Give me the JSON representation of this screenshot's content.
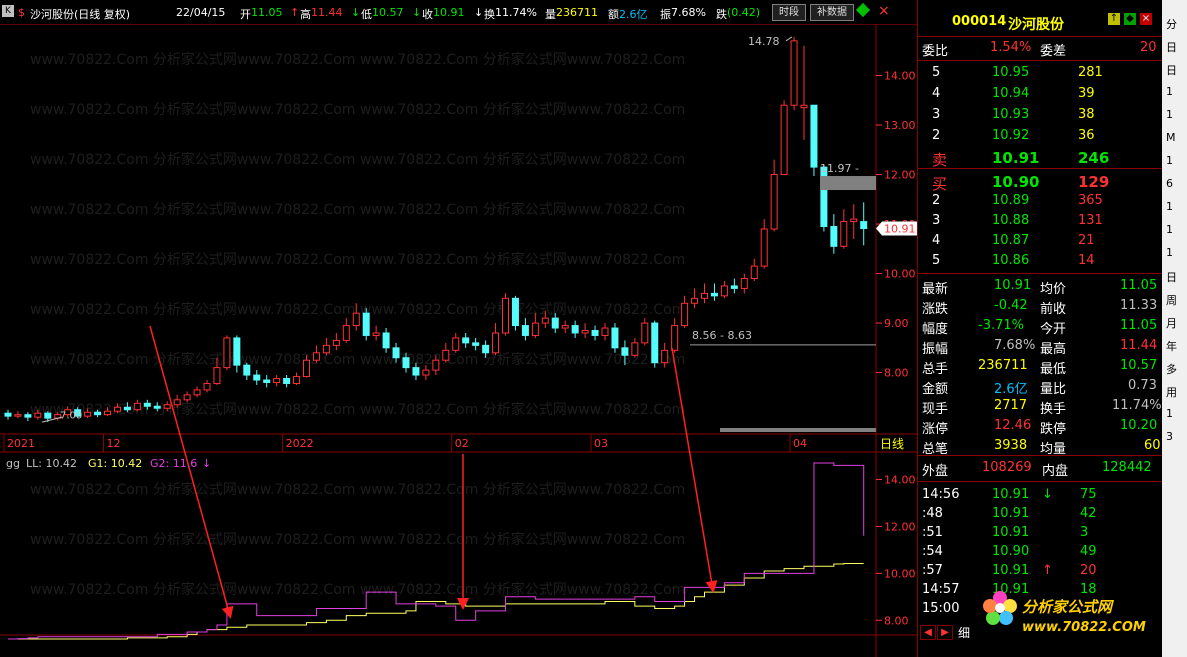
{
  "header": {
    "code_badge": "K",
    "title": "沙河股份(日线 复权)",
    "date": "22/04/15",
    "open_label": "开",
    "open": "11.05",
    "high_label": "高",
    "high": "11.44",
    "low_label": "低",
    "low": "10.57",
    "close_label": "收",
    "close": "10.91",
    "turnover_label": "换",
    "turnover": "11.74%",
    "volume_label": "量",
    "volume": "236711",
    "amount_label": "额",
    "amount": "2.6亿",
    "amplitude_label": "振",
    "amplitude": "7.68%",
    "change_label": "跌",
    "change": "(0.42)",
    "btn_time": "时段",
    "btn_supplement": "补数据"
  },
  "watermark": {
    "text": "www.70822.Com   分析家公式网www.70822.Com"
  },
  "annotations": {
    "peak_label": "14.78",
    "resistance_label": "11.97",
    "support_label": "8.56 - 8.63",
    "early_label": "7.00",
    "current_price_tag": "10.91",
    "axis_tag": "日线"
  },
  "date_axis": [
    {
      "label": "2021",
      "i": 0
    },
    {
      "label": "12",
      "i": 10
    },
    {
      "label": "2022",
      "i": 28
    },
    {
      "label": "02",
      "i": 45
    },
    {
      "label": "03",
      "i": 59
    },
    {
      "label": "04",
      "i": 79
    }
  ],
  "indicator": {
    "name": "gg",
    "ll_label": "LL: 10.42",
    "g1_label": "G1: 10.42",
    "g2_label": "G2: 11.6"
  },
  "chart_data": [
    {
      "type": "candlestick",
      "ylim": [
        6.8,
        15.0
      ],
      "yticks": [
        "8.00",
        "9.00",
        "10.00",
        "11.00",
        "12.00",
        "13.00",
        "14.00"
      ],
      "colors": {
        "up": "#ff3232",
        "down": "#54fcfc"
      },
      "candles": [
        [
          7.18,
          7.12,
          7.25,
          7.05
        ],
        [
          7.12,
          7.15,
          7.22,
          7.08
        ],
        [
          7.15,
          7.1,
          7.2,
          7.02
        ],
        [
          7.1,
          7.18,
          7.25,
          7.05
        ],
        [
          7.18,
          7.08,
          7.22,
          7.0
        ],
        [
          7.08,
          7.15,
          7.2,
          7.03
        ],
        [
          7.15,
          7.25,
          7.32,
          7.1
        ],
        [
          7.25,
          7.12,
          7.3,
          7.08
        ],
        [
          7.12,
          7.2,
          7.28,
          7.08
        ],
        [
          7.2,
          7.15,
          7.25,
          7.1
        ],
        [
          7.15,
          7.22,
          7.3,
          7.12
        ],
        [
          7.22,
          7.3,
          7.38,
          7.18
        ],
        [
          7.3,
          7.25,
          7.4,
          7.2
        ],
        [
          7.25,
          7.38,
          7.45,
          7.22
        ],
        [
          7.38,
          7.32,
          7.45,
          7.25
        ],
        [
          7.32,
          7.28,
          7.4,
          7.22
        ],
        [
          7.28,
          7.35,
          7.42,
          7.22
        ],
        [
          7.35,
          7.45,
          7.55,
          7.3
        ],
        [
          7.45,
          7.55,
          7.62,
          7.4
        ],
        [
          7.55,
          7.65,
          7.72,
          7.5
        ],
        [
          7.65,
          7.78,
          7.85,
          7.6
        ],
        [
          7.78,
          8.1,
          8.3,
          7.75
        ],
        [
          8.1,
          8.7,
          8.75,
          8.05
        ],
        [
          8.7,
          8.15,
          8.75,
          8.0
        ],
        [
          8.15,
          7.95,
          8.2,
          7.85
        ],
        [
          7.95,
          7.85,
          8.05,
          7.75
        ],
        [
          7.85,
          7.8,
          7.95,
          7.7
        ],
        [
          7.8,
          7.88,
          7.95,
          7.72
        ],
        [
          7.88,
          7.78,
          7.95,
          7.7
        ],
        [
          7.78,
          7.92,
          8.0,
          7.75
        ],
        [
          7.92,
          8.25,
          8.35,
          7.9
        ],
        [
          8.25,
          8.4,
          8.55,
          8.2
        ],
        [
          8.4,
          8.55,
          8.7,
          8.35
        ],
        [
          8.55,
          8.65,
          8.8,
          8.45
        ],
        [
          8.65,
          8.95,
          9.1,
          8.6
        ],
        [
          8.95,
          9.2,
          9.4,
          8.85
        ],
        [
          9.2,
          8.75,
          9.3,
          8.65
        ],
        [
          8.75,
          8.8,
          8.95,
          8.65
        ],
        [
          8.8,
          8.5,
          8.9,
          8.4
        ],
        [
          8.5,
          8.3,
          8.6,
          8.2
        ],
        [
          8.3,
          8.1,
          8.4,
          8.0
        ],
        [
          8.1,
          7.95,
          8.2,
          7.85
        ],
        [
          7.95,
          8.05,
          8.15,
          7.85
        ],
        [
          8.05,
          8.25,
          8.35,
          7.95
        ],
        [
          8.25,
          8.45,
          8.6,
          8.2
        ],
        [
          8.45,
          8.7,
          8.8,
          8.4
        ],
        [
          8.7,
          8.6,
          8.8,
          8.5
        ],
        [
          8.6,
          8.55,
          8.7,
          8.45
        ],
        [
          8.55,
          8.4,
          8.65,
          8.3
        ],
        [
          8.4,
          8.8,
          9.0,
          8.35
        ],
        [
          8.8,
          9.5,
          9.6,
          8.75
        ],
        [
          9.5,
          8.95,
          9.55,
          8.85
        ],
        [
          8.95,
          8.75,
          9.1,
          8.65
        ],
        [
          8.75,
          9.0,
          9.2,
          8.7
        ],
        [
          9.0,
          9.1,
          9.25,
          8.9
        ],
        [
          9.1,
          8.9,
          9.2,
          8.8
        ],
        [
          8.9,
          8.95,
          9.05,
          8.8
        ],
        [
          8.95,
          8.8,
          9.05,
          8.7
        ],
        [
          8.8,
          8.85,
          9.0,
          8.7
        ],
        [
          8.85,
          8.75,
          8.95,
          8.65
        ],
        [
          8.75,
          8.9,
          9.0,
          8.65
        ],
        [
          8.9,
          8.5,
          9.0,
          8.4
        ],
        [
          8.5,
          8.35,
          8.65,
          8.15
        ],
        [
          8.35,
          8.6,
          8.7,
          8.3
        ],
        [
          8.6,
          9.0,
          9.1,
          8.55
        ],
        [
          9.0,
          8.2,
          9.05,
          8.1
        ],
        [
          8.2,
          8.45,
          8.6,
          8.1
        ],
        [
          8.45,
          8.95,
          9.1,
          8.4
        ],
        [
          8.95,
          9.4,
          9.55,
          8.9
        ],
        [
          9.4,
          9.5,
          9.7,
          9.3
        ],
        [
          9.5,
          9.6,
          9.8,
          9.4
        ],
        [
          9.6,
          9.55,
          9.8,
          9.45
        ],
        [
          9.55,
          9.75,
          9.85,
          9.5
        ],
        [
          9.75,
          9.7,
          9.9,
          9.6
        ],
        [
          9.7,
          9.9,
          10.0,
          9.6
        ],
        [
          9.9,
          10.15,
          10.3,
          9.85
        ],
        [
          10.15,
          10.9,
          11.1,
          10.1
        ],
        [
          10.9,
          12.0,
          12.3,
          10.85
        ],
        [
          12.0,
          13.4,
          13.5,
          12.4
        ],
        [
          13.4,
          14.7,
          14.78,
          13.3
        ],
        [
          13.35,
          13.4,
          14.6,
          12.7
        ],
        [
          13.4,
          12.15,
          13.3,
          11.97
        ],
        [
          12.15,
          10.95,
          12.2,
          10.85
        ],
        [
          10.95,
          10.55,
          11.2,
          10.4
        ],
        [
          10.55,
          11.05,
          11.3,
          10.5
        ],
        [
          11.05,
          11.1,
          11.4,
          10.7
        ],
        [
          11.05,
          10.91,
          11.44,
          10.57
        ]
      ]
    },
    {
      "type": "line",
      "ylim": [
        7.5,
        15.0
      ],
      "yticks": [
        "8.00",
        "10.00",
        "12.00",
        "14.00"
      ],
      "series": [
        {
          "name": "LL",
          "color": "#ffff60",
          "values": [
            7.2,
            7.2,
            7.2,
            7.2,
            7.2,
            7.2,
            7.2,
            7.2,
            7.2,
            7.2,
            7.2,
            7.2,
            7.25,
            7.25,
            7.25,
            7.25,
            7.3,
            7.3,
            7.4,
            7.5,
            7.6,
            7.6,
            7.7,
            7.7,
            7.8,
            7.8,
            7.8,
            7.8,
            7.8,
            7.8,
            7.9,
            7.9,
            8.0,
            8.0,
            8.2,
            8.2,
            8.3,
            8.3,
            8.3,
            8.3,
            8.4,
            8.8,
            8.8,
            8.8,
            8.7,
            8.7,
            8.6,
            8.6,
            8.6,
            8.6,
            8.7,
            8.7,
            8.7,
            8.7,
            8.7,
            8.7,
            8.7,
            8.7,
            8.7,
            8.7,
            8.8,
            8.8,
            8.8,
            8.6,
            8.6,
            8.5,
            8.5,
            8.6,
            8.8,
            9.0,
            9.2,
            9.2,
            9.5,
            9.5,
            9.8,
            9.8,
            10.1,
            10.1,
            10.2,
            10.2,
            10.3,
            10.3,
            10.3,
            10.4,
            10.42,
            10.42,
            10.42
          ]
        },
        {
          "name": "G1",
          "color": "#e040e0",
          "values": [
            7.2,
            7.22,
            7.25,
            7.3,
            7.3,
            7.3,
            7.3,
            7.3,
            7.3,
            7.3,
            7.3,
            7.3,
            7.3,
            7.3,
            7.3,
            7.4,
            7.4,
            7.4,
            7.5,
            7.5,
            7.6,
            7.8,
            8.7,
            8.7,
            8.7,
            8.2,
            8.2,
            8.2,
            8.2,
            8.2,
            8.2,
            8.5,
            8.5,
            8.5,
            8.5,
            8.5,
            9.2,
            9.2,
            9.2,
            8.7,
            8.7,
            8.7,
            8.7,
            8.6,
            8.6,
            8.0,
            8.0,
            8.4,
            8.4,
            8.4,
            9.0,
            9.0,
            9.0,
            8.9,
            8.9,
            8.9,
            8.9,
            8.9,
            8.9,
            8.9,
            8.9,
            8.9,
            8.9,
            9.0,
            9.0,
            8.8,
            8.8,
            8.8,
            9.4,
            9.4,
            9.4,
            9.4,
            9.6,
            9.6,
            10.0,
            10.0,
            10.0,
            10.0,
            10.0,
            10.0,
            10.0,
            14.7,
            14.7,
            14.6,
            14.6,
            14.6,
            11.6
          ]
        }
      ]
    }
  ],
  "panel": {
    "code": "000014",
    "name": "沙河股份",
    "weibi_label": "委比",
    "weibi": "1.54%",
    "weicha_label": "委差",
    "weicha": "20",
    "asks": [
      {
        "level": "5",
        "price": "10.95",
        "vol": "281"
      },
      {
        "level": "4",
        "price": "10.94",
        "vol": "39"
      },
      {
        "level": "3",
        "price": "10.93",
        "vol": "38"
      },
      {
        "level": "2",
        "price": "10.92",
        "vol": "36"
      },
      {
        "level": "卖",
        "price": "10.91",
        "vol": "246"
      }
    ],
    "bids": [
      {
        "level": "买",
        "price": "10.90",
        "vol": "129"
      },
      {
        "level": "2",
        "price": "10.89",
        "vol": "365"
      },
      {
        "level": "3",
        "price": "10.88",
        "vol": "131"
      },
      {
        "level": "4",
        "price": "10.87",
        "vol": "21"
      },
      {
        "level": "5",
        "price": "10.86",
        "vol": "14"
      }
    ],
    "stats": [
      {
        "l1": "最新",
        "v1": "10.91",
        "c1": "green",
        "l2": "均价",
        "v2": "11.05",
        "c2": "green"
      },
      {
        "l1": "涨跌",
        "v1": "-0.42",
        "c1": "green",
        "l2": "前收",
        "v2": "11.33",
        "c2": "gray"
      },
      {
        "l1": "幅度",
        "v1": "-3.71%",
        "c1": "green",
        "l2": "今开",
        "v2": "11.05",
        "c2": "green"
      },
      {
        "l1": "振幅",
        "v1": "7.68%",
        "c1": "gray",
        "l2": "最高",
        "v2": "11.44",
        "c2": "red"
      },
      {
        "l1": "总手",
        "v1": "236711",
        "c1": "yellow",
        "l2": "最低",
        "v2": "10.57",
        "c2": "green"
      },
      {
        "l1": "金额",
        "v1": "2.6亿",
        "c1": "cyan",
        "l2": "量比",
        "v2": "0.73",
        "c2": "gray"
      },
      {
        "l1": "现手",
        "v1": "2717",
        "c1": "yellow",
        "l2": "换手",
        "v2": "11.74%",
        "c2": "gray"
      },
      {
        "l1": "涨停",
        "v1": "12.46",
        "c1": "red",
        "l2": "跌停",
        "v2": "10.20",
        "c2": "green"
      },
      {
        "l1": "总笔",
        "v1": "3938",
        "c1": "yellow",
        "l2": "均量",
        "v2": "60",
        "c2": "yellow"
      }
    ],
    "waipan_label": "外盘",
    "waipan": "108269",
    "neipan_label": "内盘",
    "neipan": "128442",
    "ticks": [
      {
        "time": "14:56",
        "price": "10.91",
        "arrow": "↓",
        "arrow_color": "green",
        "vol": "75"
      },
      {
        "time": ":48",
        "price": "10.91",
        "arrow": "",
        "arrow_color": "green",
        "vol": "42"
      },
      {
        "time": ":51",
        "price": "10.91",
        "arrow": "",
        "arrow_color": "green",
        "vol": "3"
      },
      {
        "time": ":54",
        "price": "10.90",
        "arrow": "",
        "arrow_color": "green",
        "vol": "49"
      },
      {
        "time": ":57",
        "price": "10.91",
        "arrow": "↑",
        "arrow_color": "red",
        "vol": "20"
      },
      {
        "time": "14:57",
        "price": "10.91",
        "arrow": "",
        "arrow_color": "green",
        "vol": "18"
      },
      {
        "time": "15:00",
        "price": "",
        "arrow": "",
        "arrow_color": "green",
        "vol": ""
      }
    ],
    "bottom_tab": "细",
    "logo_text": "分析家公式网",
    "logo_url": "www.70822.COM"
  },
  "side_tabs": [
    "分",
    "日",
    "日",
    "1",
    "1",
    "M",
    "1",
    "6",
    "1",
    "1",
    "1",
    "日",
    "周",
    "月",
    "年",
    "多",
    "用",
    "1",
    "3"
  ]
}
